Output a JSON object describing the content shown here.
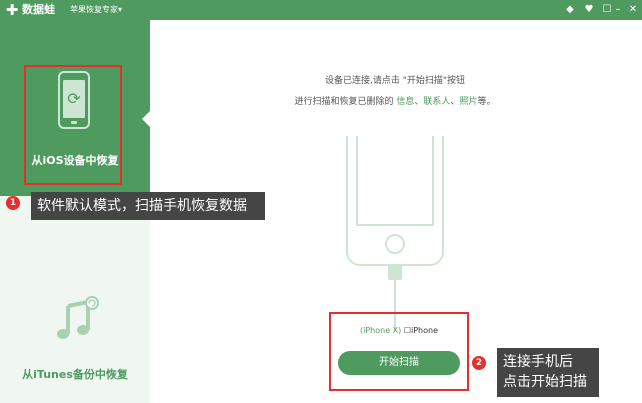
{
  "titlebar": {
    "logo": "✚",
    "app_name": "数据蛙",
    "subtitle": "苹果恢复专家▾",
    "icons": [
      "diamond-icon",
      "heart-icon",
      "chat-icon",
      "minimize-icon",
      "close-icon"
    ]
  },
  "sidebar": {
    "items": [
      {
        "label": "从iOS设备中恢复",
        "selected": true
      },
      {
        "label": "从iTunes备份中恢复",
        "selected": false
      }
    ]
  },
  "main": {
    "instruction_line1": "设备已连接,请点击 \"开始扫描\"按钮",
    "instruction_line2_prefix": "进行扫描和恢复已删除的 ",
    "link_info": "信息",
    "sep1": "、",
    "link_contacts": "联系人",
    "sep2": "、",
    "link_photos": "照片",
    "instruction_line2_suffix": "等。",
    "device_model": "(iPhone X)",
    "device_name": "iPhone",
    "start_button": "开始扫描"
  },
  "annotations": {
    "a1_num": "1",
    "a1_text": "软件默认模式，扫描手机恢复数据",
    "a2_num": "2",
    "a2_line1": "连接手机后",
    "a2_line2": "点击开始扫描"
  },
  "colors": {
    "accent": "#4f9a5e",
    "highlight": "#e52e2e",
    "tooltip": "#454545"
  }
}
